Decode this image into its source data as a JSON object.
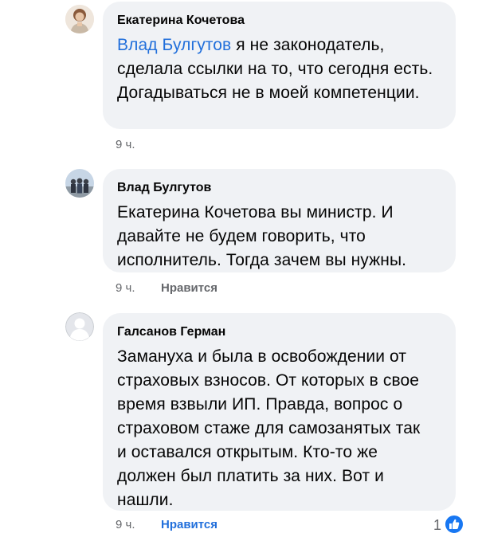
{
  "comments": [
    {
      "author": "Екатерина Кочетова",
      "mention": "Влад Булгутов",
      "text": " я не законодатель, сделала ссылки на то, что сегодня есть. Догадываться не в моей компетенции.",
      "time": "9 ч."
    },
    {
      "author": "Влад Булгутов",
      "text": "Екатерина Кочетова вы министр. И давайте не будем говорить, что исполнитель. Тогда зачем вы нужны.",
      "time": "9 ч.",
      "like_label": "Нравится"
    },
    {
      "author": "Галсанов Герман",
      "text": "Замануха и была в освобождении от страховых взносов. От которых в свое время взвыли ИП. Правда, вопрос о страховом стаже для самозанятых так и оставался открытым. Кто-то же должен был платить за них. Вот и нашли.",
      "time": "9 ч.",
      "like_label": "Нравится",
      "reaction_count": "1"
    }
  ],
  "colors": {
    "bubble": "#f0f2f5",
    "mention": "#216fdb",
    "like_active": "#1877f2",
    "like_inactive": "#65676b",
    "meta": "#65676b"
  },
  "icons": {
    "reaction": "like-thumb-icon",
    "default_avatar": "default-avatar-icon"
  }
}
